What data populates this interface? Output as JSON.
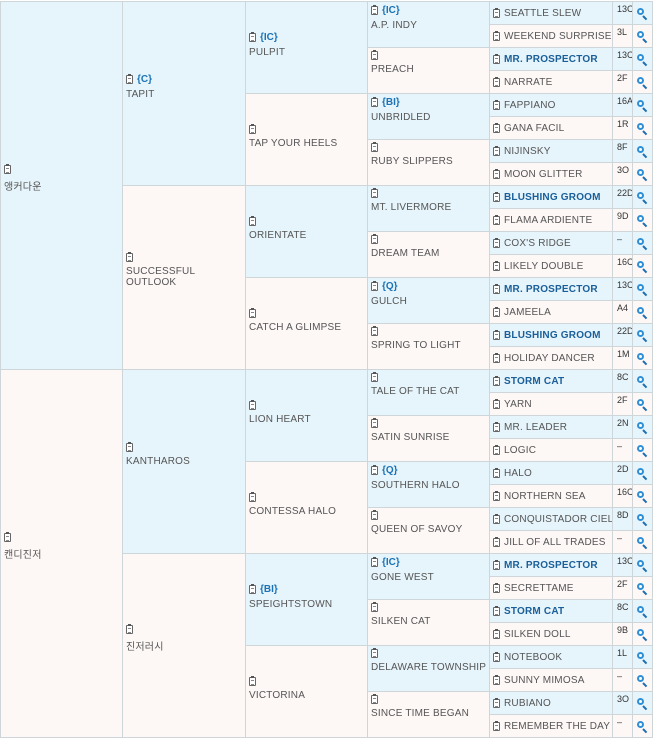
{
  "pedigree": {
    "gen1": [
      {
        "name": "앵커다운",
        "badge": ""
      },
      {
        "name": "캔디진저",
        "badge": ""
      }
    ],
    "gen2": [
      {
        "name": "TAPIT",
        "badge": "{C}"
      },
      {
        "name": "SUCCESSFUL OUTLOOK",
        "badge": ""
      },
      {
        "name": "KANTHAROS",
        "badge": ""
      },
      {
        "name": "진저러시",
        "badge": ""
      }
    ],
    "gen3": [
      {
        "name": "PULPIT",
        "badge": "{IC}"
      },
      {
        "name": "TAP YOUR HEELS",
        "badge": ""
      },
      {
        "name": "ORIENTATE",
        "badge": ""
      },
      {
        "name": "CATCH A GLIMPSE",
        "badge": ""
      },
      {
        "name": "LION HEART",
        "badge": ""
      },
      {
        "name": "CONTESSA HALO",
        "badge": ""
      },
      {
        "name": "SPEIGHTSTOWN",
        "badge": "{BI}"
      },
      {
        "name": "VICTORINA",
        "badge": ""
      }
    ],
    "gen4": [
      {
        "name": "A.P. INDY",
        "badge": "{IC}"
      },
      {
        "name": "PREACH",
        "badge": ""
      },
      {
        "name": "UNBRIDLED",
        "badge": "{BI}"
      },
      {
        "name": "RUBY SLIPPERS",
        "badge": ""
      },
      {
        "name": "MT. LIVERMORE",
        "badge": ""
      },
      {
        "name": "DREAM TEAM",
        "badge": ""
      },
      {
        "name": "GULCH",
        "badge": "{Q}"
      },
      {
        "name": "SPRING TO LIGHT",
        "badge": ""
      },
      {
        "name": "TALE OF THE CAT",
        "badge": ""
      },
      {
        "name": "SATIN SUNRISE",
        "badge": ""
      },
      {
        "name": "SOUTHERN HALO",
        "badge": "{Q}"
      },
      {
        "name": "QUEEN OF SAVOY",
        "badge": ""
      },
      {
        "name": "GONE WEST",
        "badge": "{IC}"
      },
      {
        "name": "SILKEN CAT",
        "badge": ""
      },
      {
        "name": "DELAWARE TOWNSHIP",
        "badge": ""
      },
      {
        "name": "SINCE TIME BEGAN",
        "badge": ""
      }
    ],
    "gen5": [
      {
        "name": "SEATTLE SLEW",
        "code": "13C",
        "highlight": false
      },
      {
        "name": "WEEKEND SURPRISE",
        "code": "3L",
        "highlight": false
      },
      {
        "name": "MR. PROSPECTOR",
        "code": "13C",
        "highlight": true
      },
      {
        "name": "NARRATE",
        "code": "2F",
        "highlight": false
      },
      {
        "name": "FAPPIANO",
        "code": "16A",
        "highlight": false
      },
      {
        "name": "GANA FACIL",
        "code": "1R",
        "highlight": false
      },
      {
        "name": "NIJINSKY",
        "code": "8F",
        "highlight": false
      },
      {
        "name": "MOON GLITTER",
        "code": "3O",
        "highlight": false
      },
      {
        "name": "BLUSHING GROOM",
        "code": "22D",
        "highlight": true
      },
      {
        "name": "FLAMA ARDIENTE",
        "code": "9D",
        "highlight": false
      },
      {
        "name": "COX'S RIDGE",
        "code": "–",
        "highlight": false
      },
      {
        "name": "LIKELY DOUBLE",
        "code": "16C",
        "highlight": false
      },
      {
        "name": "MR. PROSPECTOR",
        "code": "13C",
        "highlight": true
      },
      {
        "name": "JAMEELA",
        "code": "A4",
        "highlight": false
      },
      {
        "name": "BLUSHING GROOM",
        "code": "22D",
        "highlight": true
      },
      {
        "name": "HOLIDAY DANCER",
        "code": "1M",
        "highlight": false
      },
      {
        "name": "STORM CAT",
        "code": "8C",
        "highlight": true
      },
      {
        "name": "YARN",
        "code": "2F",
        "highlight": false
      },
      {
        "name": "MR. LEADER",
        "code": "2N",
        "highlight": false
      },
      {
        "name": "LOGIC",
        "code": "–",
        "highlight": false
      },
      {
        "name": "HALO",
        "code": "2D",
        "highlight": false
      },
      {
        "name": "NORTHERN SEA",
        "code": "16C",
        "highlight": false
      },
      {
        "name": "CONQUISTADOR CIELO",
        "code": "8D",
        "highlight": false
      },
      {
        "name": "JILL OF ALL TRADES",
        "code": "–",
        "highlight": false
      },
      {
        "name": "MR. PROSPECTOR",
        "code": "13C",
        "highlight": true
      },
      {
        "name": "SECRETTAME",
        "code": "2F",
        "highlight": false
      },
      {
        "name": "STORM CAT",
        "code": "8C",
        "highlight": true
      },
      {
        "name": "SILKEN DOLL",
        "code": "9B",
        "highlight": false
      },
      {
        "name": "NOTEBOOK",
        "code": "1L",
        "highlight": false
      },
      {
        "name": "SUNNY MIMOSA",
        "code": "–",
        "highlight": false
      },
      {
        "name": "RUBIANO",
        "code": "3O",
        "highlight": false
      },
      {
        "name": "REMEMBER THE DAY",
        "code": "–",
        "highlight": false
      }
    ]
  }
}
